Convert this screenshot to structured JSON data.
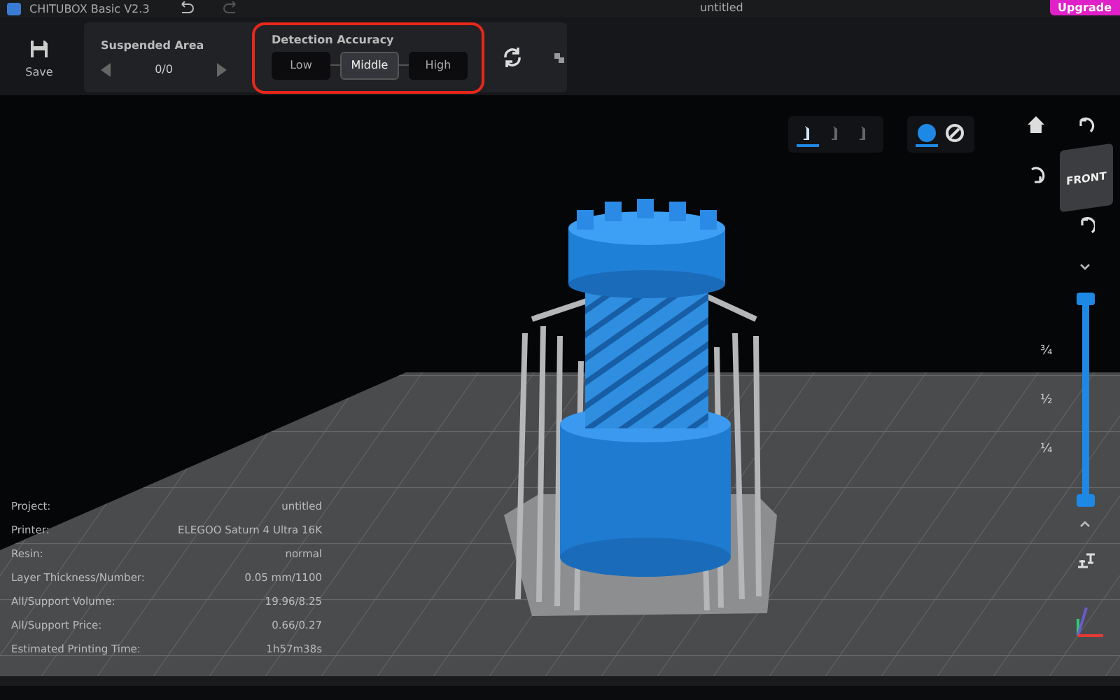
{
  "title_bar": {
    "app_title": "CHITUBOX Basic V2.3",
    "document": "untitled",
    "upgrade_button": "Upgrade"
  },
  "toolbar": {
    "save": "Save",
    "suspended_area": {
      "label": "Suspended Area",
      "value": "0/0"
    },
    "detection_accuracy": {
      "label": "Detection Accuracy",
      "highlighted": true,
      "options": [
        {
          "label": "Low",
          "selected": false
        },
        {
          "label": "Middle",
          "selected": true
        },
        {
          "label": "High",
          "selected": false
        }
      ]
    }
  },
  "view_tools": {
    "support_modes": [
      {
        "selected": true
      },
      {
        "selected": false
      },
      {
        "selected": false
      }
    ],
    "render_modes": [
      {
        "kind": "solid",
        "selected": true
      },
      {
        "kind": "xray",
        "selected": false
      }
    ]
  },
  "view_cube": {
    "face": "FRONT"
  },
  "layer_slider": {
    "level": 1,
    "ticks": [
      "¾",
      "½",
      "¼"
    ]
  },
  "info_panel": [
    {
      "label": "Project:",
      "value": "untitled"
    },
    {
      "label": "Printer:",
      "value": "ELEGOO Saturn 4 Ultra 16K"
    },
    {
      "label": "Resin:",
      "value": "normal"
    },
    {
      "label": "Layer Thickness/Number:",
      "value": "0.05 mm/1100"
    },
    {
      "label": "All/Support Volume:",
      "value": "19.96/8.25"
    },
    {
      "label": "All/Support Price:",
      "value": "0.66/0.27"
    },
    {
      "label": "Estimated Printing Time:",
      "value": "1h57m38s"
    }
  ]
}
